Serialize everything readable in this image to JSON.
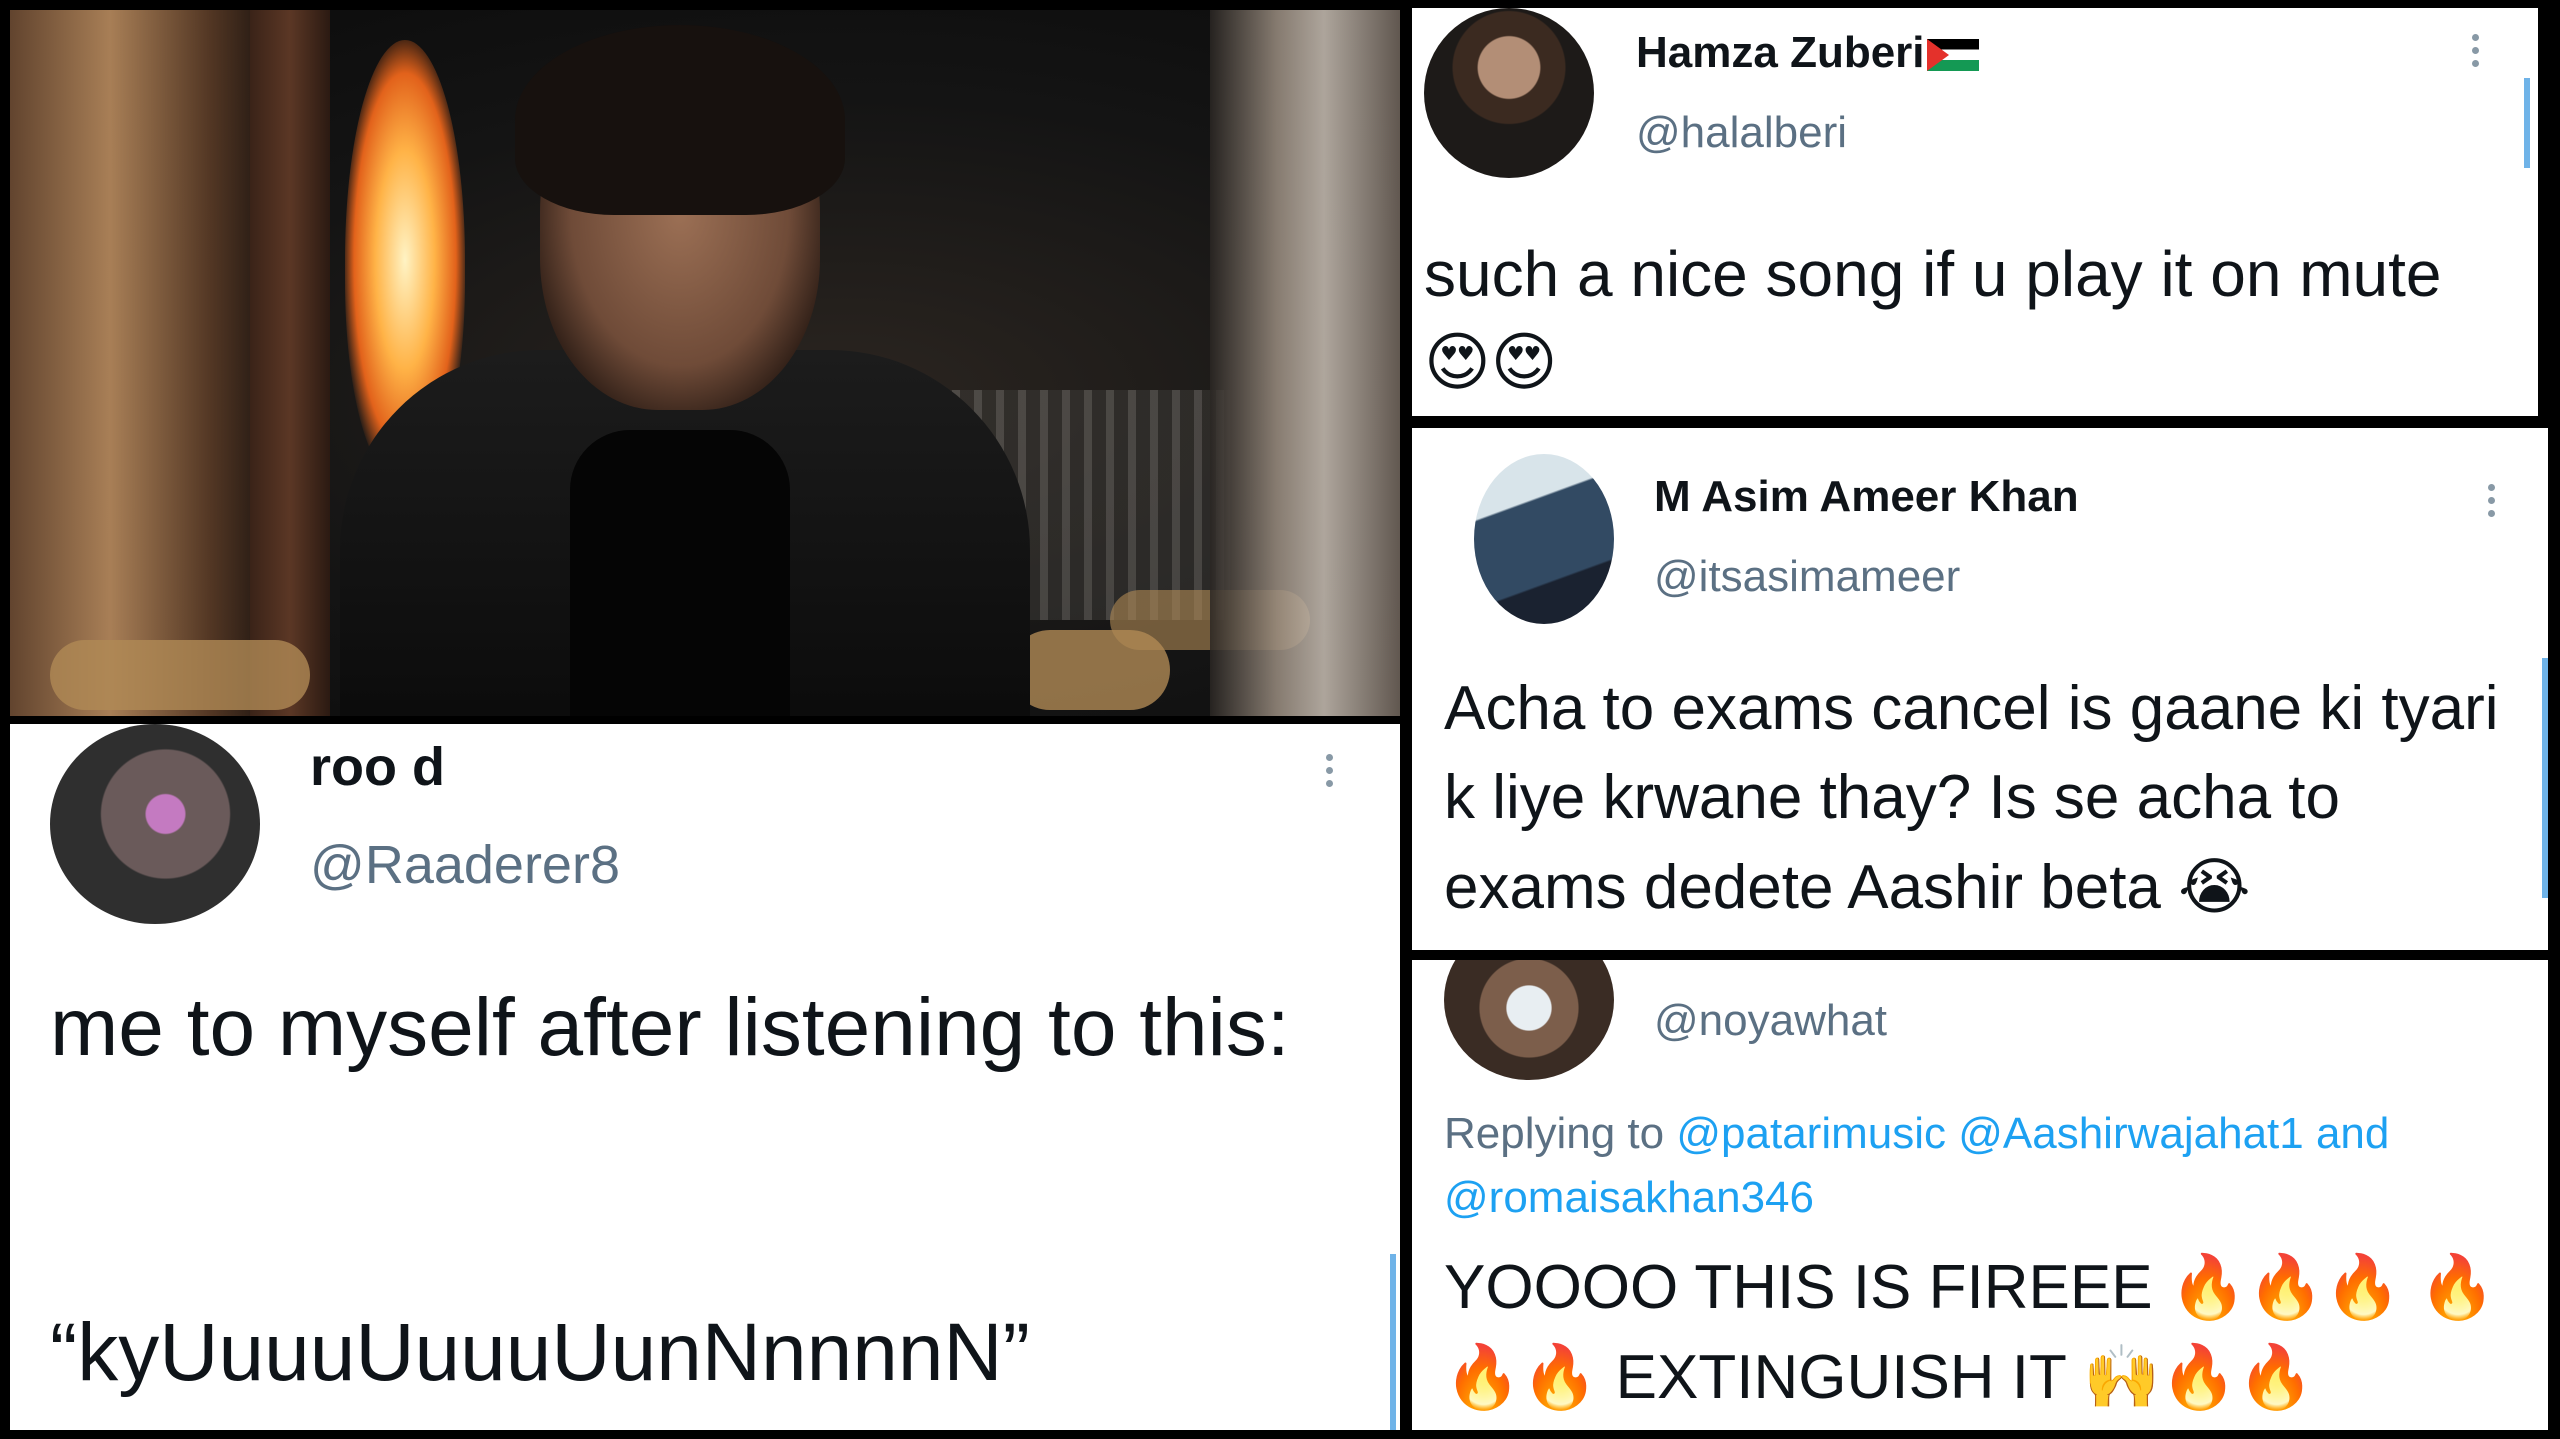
{
  "tweets": {
    "hamza": {
      "name": "Hamza Zuberi",
      "handle": "@halalberi",
      "text": "such a nice song if u play it on mute",
      "emoji": "😍😍"
    },
    "asim": {
      "name": "M Asim Ameer Khan",
      "handle": "@itsasimameer",
      "text": "Acha to exams cancel is gaane ki tyari k liye krwane thay? Is se acha to exams dedete Aashir beta",
      "emoji": "😭"
    },
    "roo": {
      "name": "roo d",
      "handle": "@Raaderer8",
      "text_line1": "me to myself after listening to this:",
      "text_line2": "“kyUuuuUuuuUunNnnnnN”"
    },
    "noya": {
      "handle": "@noyawhat",
      "replying_prefix": "Replying to",
      "replying_to": "@patarimusic @Aashirwajahat1 and @romaisakhan346",
      "text_part1": "YOOOO THIS IS FIREEE",
      "fire1": "🔥🔥🔥",
      "fire2": "🔥🔥🔥",
      "text_part2": "EXTINGUISH IT",
      "end_emoji": "🙌🔥🔥"
    }
  },
  "colors": {
    "name": "#0f1419",
    "handle": "#5b7083",
    "link": "#1da1f2",
    "scrollbar": "#6fb3e8"
  }
}
